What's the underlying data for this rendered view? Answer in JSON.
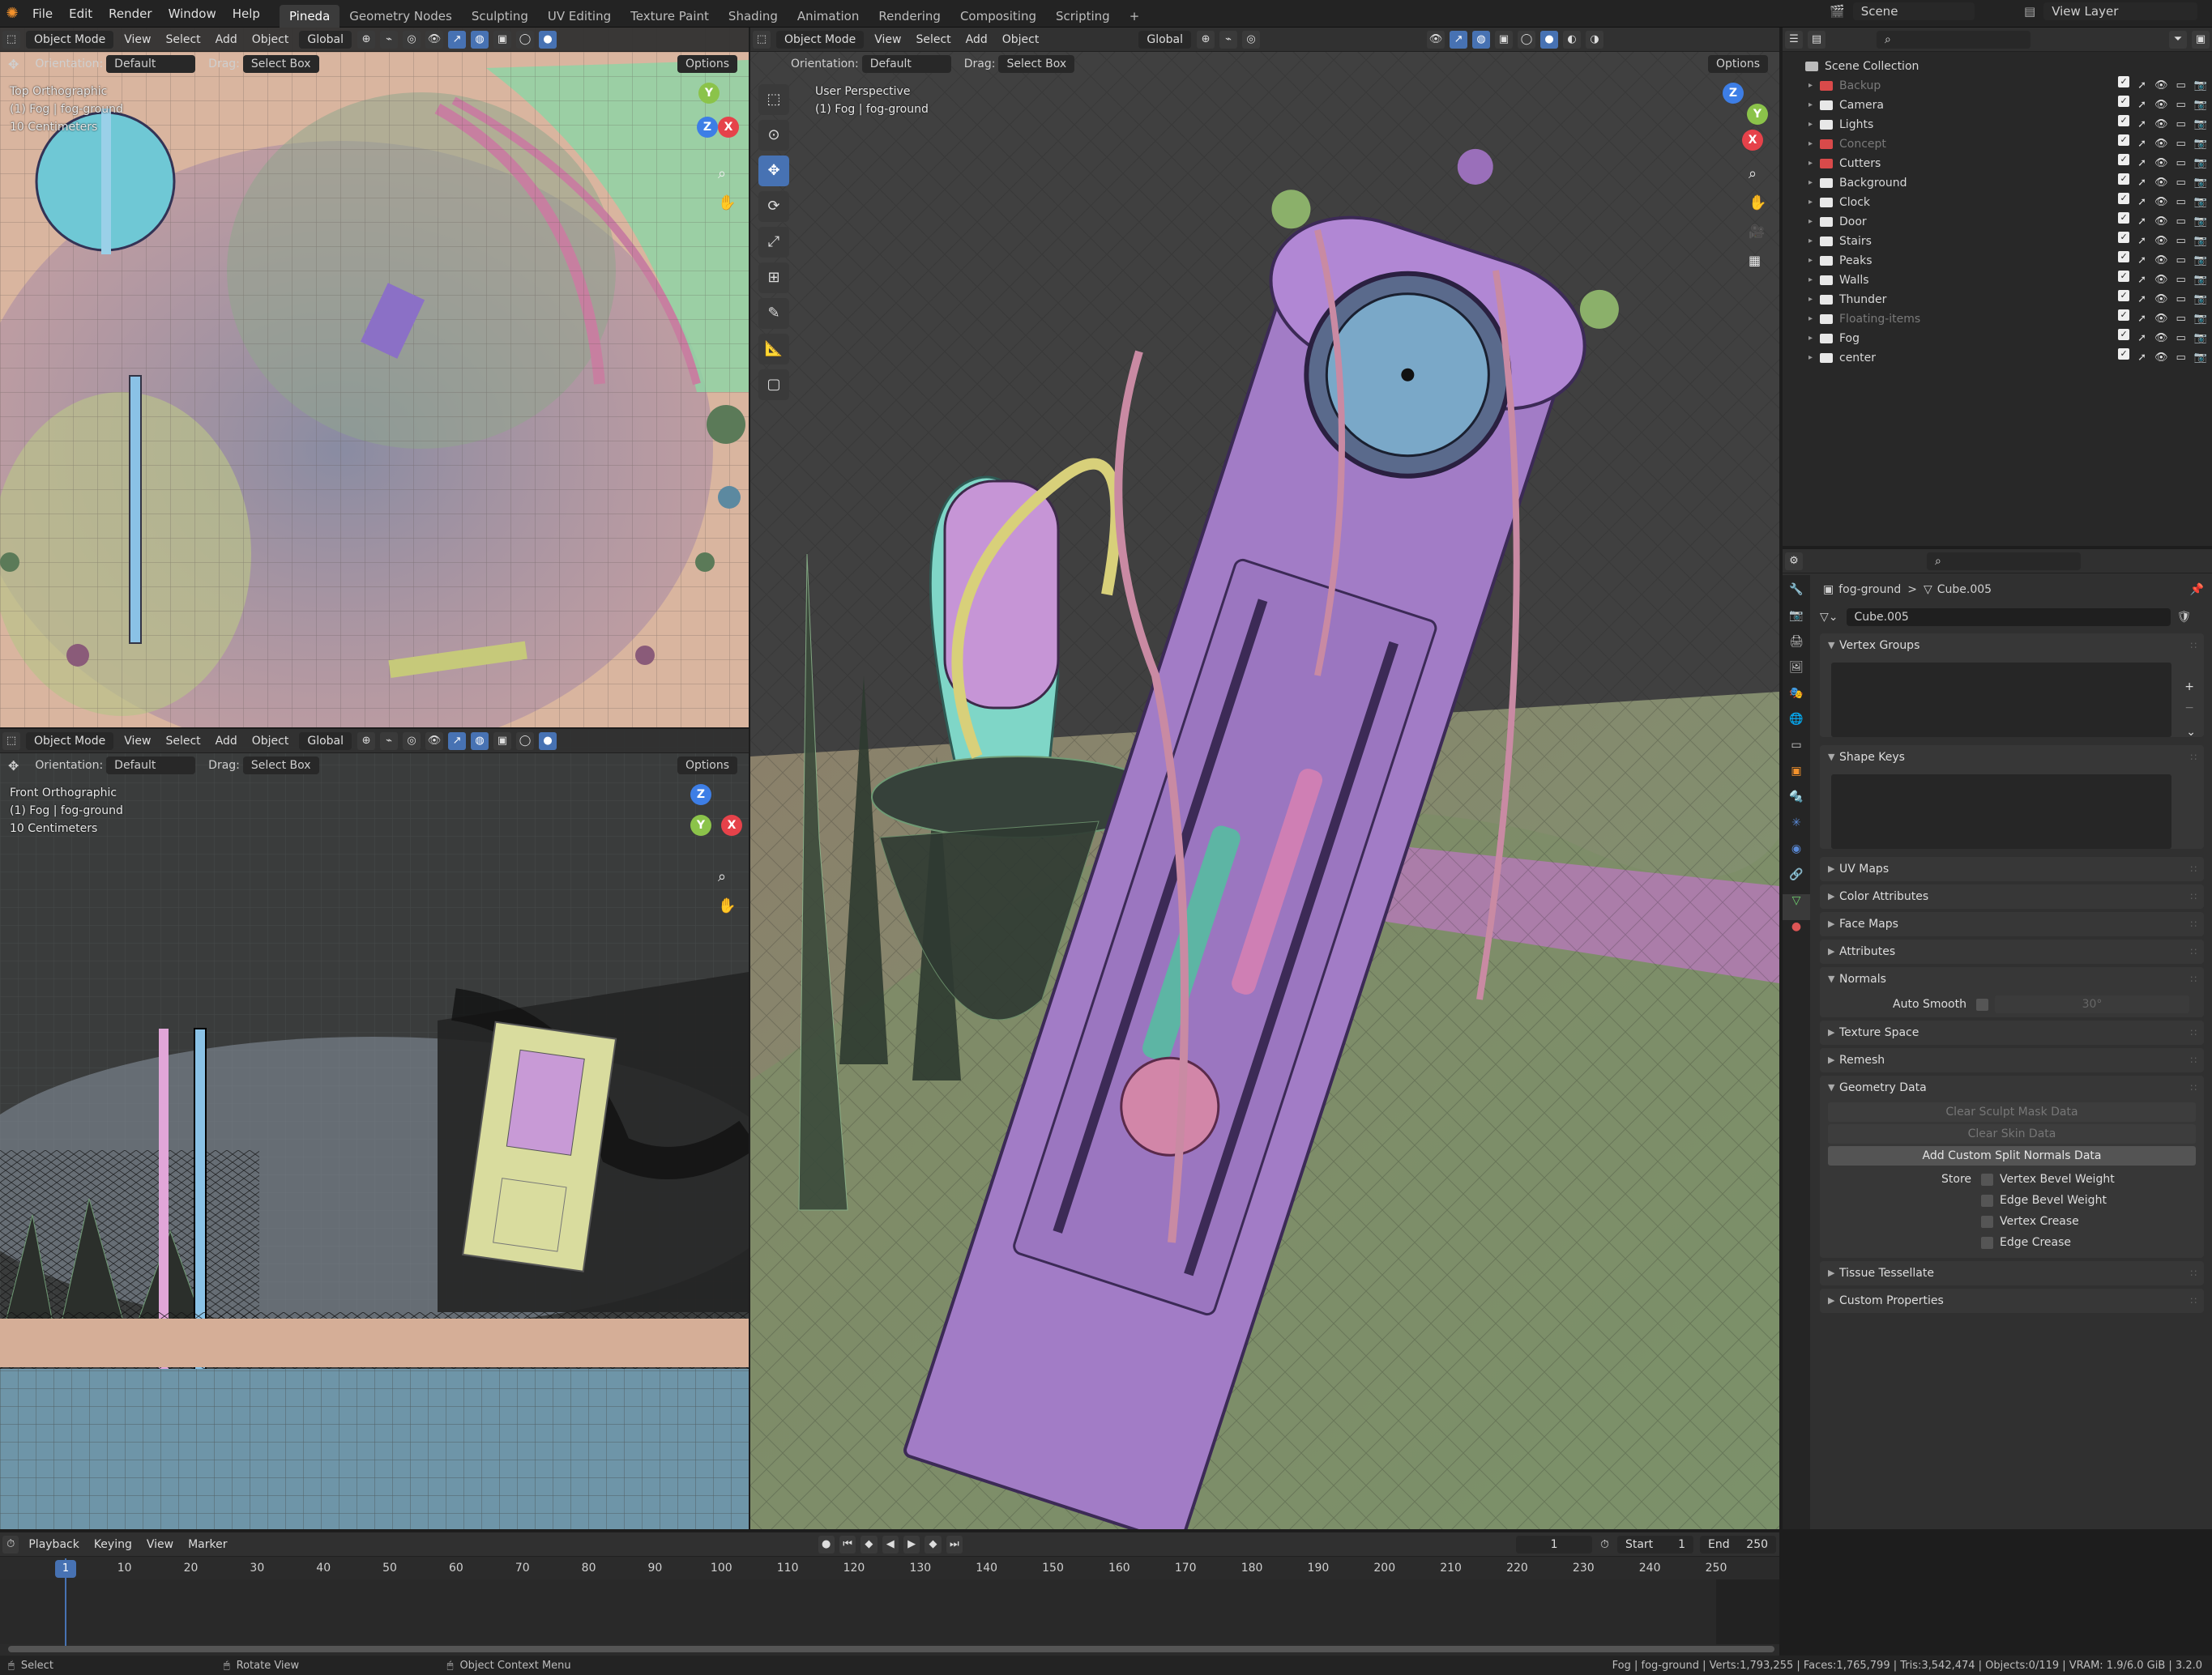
{
  "topbar": {
    "menus": [
      "File",
      "Edit",
      "Render",
      "Window",
      "Help"
    ],
    "workspaces": [
      "Pineda",
      "Geometry Nodes",
      "Sculpting",
      "UV Editing",
      "Texture Paint",
      "Shading",
      "Animation",
      "Rendering",
      "Compositing",
      "Scripting"
    ],
    "active_workspace": "Pineda",
    "add_tab": "+",
    "scene": "Scene",
    "view_layer": "View Layer"
  },
  "viewport_header": {
    "mode": "Object Mode",
    "menus": [
      "View",
      "Select",
      "Add",
      "Object"
    ],
    "transform": "Global",
    "orientation_label": "Orientation:",
    "orientation_value": "Default",
    "drag_label": "Drag:",
    "drag_value": "Select Box",
    "options": "Options"
  },
  "viewports": {
    "top": {
      "view": "Top Orthographic",
      "object": "(1) Fog | fog-ground",
      "scale": "10 Centimeters"
    },
    "front": {
      "view": "Front Orthographic",
      "object": "(1) Fog | fog-ground",
      "scale": "10 Centimeters"
    },
    "persp": {
      "view": "User Perspective",
      "object": "(1) Fog | fog-ground"
    }
  },
  "gizmo": {
    "x": "X",
    "y": "Y",
    "z": "Z"
  },
  "outliner": {
    "root": "Scene Collection",
    "items": [
      {
        "name": "Backup",
        "dim": true
      },
      {
        "name": "Camera",
        "dim": false
      },
      {
        "name": "Lights",
        "dim": false
      },
      {
        "name": "Concept",
        "dim": true
      },
      {
        "name": "Cutters",
        "dim": false
      },
      {
        "name": "Background",
        "dim": false
      },
      {
        "name": "Clock",
        "dim": false
      },
      {
        "name": "Door",
        "dim": false
      },
      {
        "name": "Stairs",
        "dim": false
      },
      {
        "name": "Peaks",
        "dim": false
      },
      {
        "name": "Walls",
        "dim": false
      },
      {
        "name": "Thunder",
        "dim": false
      },
      {
        "name": "Floating-items",
        "dim": true
      },
      {
        "name": "Fog",
        "dim": false
      },
      {
        "name": "center",
        "dim": false
      }
    ]
  },
  "properties": {
    "breadcrumb_object": "fog-ground",
    "breadcrumb_sep": ">",
    "breadcrumb_data": "Cube.005",
    "mesh_name": "Cube.005",
    "panels": {
      "vertex_groups": "Vertex Groups",
      "shape_keys": "Shape Keys",
      "uv_maps": "UV Maps",
      "color_attributes": "Color Attributes",
      "face_maps": "Face Maps",
      "attributes": "Attributes",
      "normals": "Normals",
      "auto_smooth": "Auto Smooth",
      "auto_smooth_angle": "30°",
      "texture_space": "Texture Space",
      "remesh": "Remesh",
      "geometry_data": "Geometry Data",
      "clear_sculpt": "Clear Sculpt Mask Data",
      "clear_skin": "Clear Skin Data",
      "add_split_normals": "Add Custom Split Normals Data",
      "store": "Store",
      "store_options": [
        "Vertex Bevel Weight",
        "Edge Bevel Weight",
        "Vertex Crease",
        "Edge Crease"
      ],
      "tissue": "Tissue Tessellate",
      "custom_props": "Custom Properties"
    }
  },
  "timeline": {
    "menus": [
      "Playback",
      "Keying",
      "View",
      "Marker"
    ],
    "current_frame": "1",
    "start_label": "Start",
    "start": "1",
    "end_label": "End",
    "end": "250",
    "ticks": [
      "1",
      "10",
      "20",
      "30",
      "40",
      "50",
      "60",
      "70",
      "80",
      "90",
      "100",
      "110",
      "120",
      "130",
      "140",
      "150",
      "160",
      "170",
      "180",
      "190",
      "200",
      "210",
      "220",
      "230",
      "240",
      "250"
    ]
  },
  "statusbar": {
    "select": "Select",
    "rotate": "Rotate View",
    "context": "Object Context Menu",
    "stats": "Fog | fog-ground | Verts:1,793,255 | Faces:1,765,799 | Tris:3,542,474 | Objects:0/119 | VRAM: 1.9/6.0 GiB | 3.2.0"
  },
  "colors": {
    "accent": "#4772b3",
    "x_axis": "#e6424a",
    "y_axis": "#8bc34a",
    "z_axis": "#3d7ee6"
  }
}
